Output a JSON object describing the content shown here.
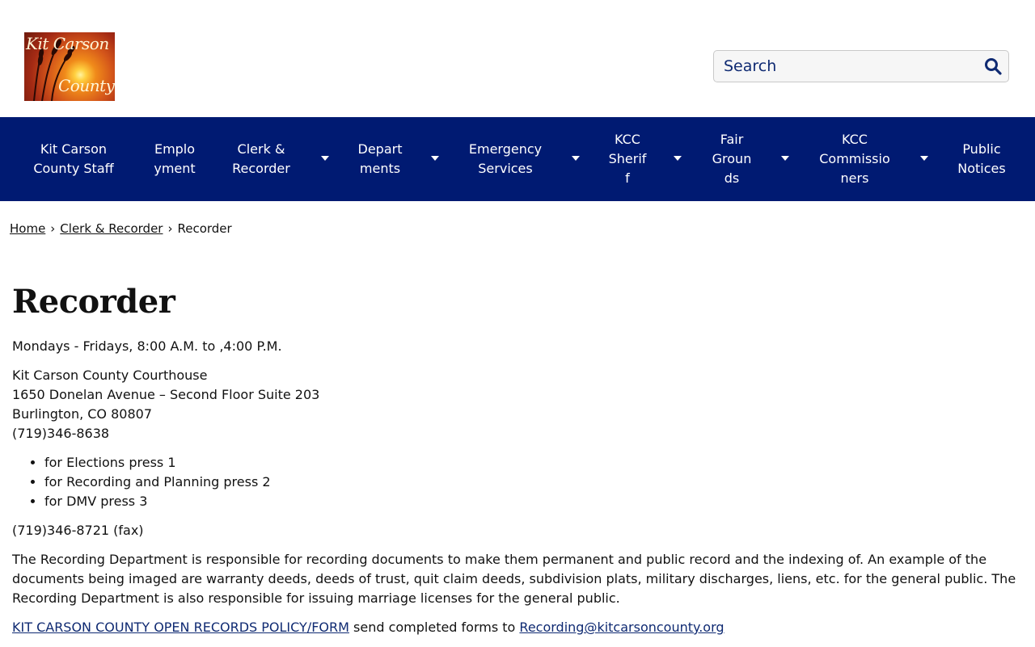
{
  "logo": {
    "line1": "Kit Carson",
    "line2": "County"
  },
  "search": {
    "placeholder": "Search",
    "icon": "search-icon"
  },
  "nav": {
    "items": [
      {
        "label_lines": [
          "Kit Carson",
          "County Staff"
        ],
        "dropdown": false
      },
      {
        "label_lines": [
          "Emplo",
          "yment"
        ],
        "dropdown": false
      },
      {
        "label_lines": [
          "Clerk &",
          "Recorder"
        ],
        "dropdown": true
      },
      {
        "label_lines": [
          "Depart",
          "ments"
        ],
        "dropdown": true
      },
      {
        "label_lines": [
          "Emergency",
          "Services"
        ],
        "dropdown": true
      },
      {
        "label_lines": [
          "KCC",
          "Sherif",
          "f"
        ],
        "dropdown": true
      },
      {
        "label_lines": [
          "Fair",
          "Groun",
          "ds"
        ],
        "dropdown": true
      },
      {
        "label_lines": [
          "KCC",
          "Commissio",
          "ners"
        ],
        "dropdown": true
      },
      {
        "label_lines": [
          "Public",
          "Notices"
        ],
        "dropdown": false
      }
    ],
    "colors": {
      "background": "#001a72",
      "text": "#ffffff"
    }
  },
  "breadcrumb": {
    "home": "Home",
    "parent": "Clerk & Recorder",
    "current": "Recorder",
    "separator": "›"
  },
  "page": {
    "title": "Recorder",
    "hours": "Mondays - Fridays, 8:00 A.M. to ,4:00 P.M.",
    "address_lines": [
      "Kit Carson County Courthouse",
      "1650 Donelan Avenue – Second Floor Suite 203",
      "Burlington, CO 80807",
      "(719)346-8638"
    ],
    "phone_options": [
      "for Elections press 1",
      "for Recording and Planning press 2",
      "for DMV press 3"
    ],
    "fax": "(719)346-8721 (fax)",
    "description": "The Recording Department is responsible for recording documents to make them permanent and public record and the indexing of.  An example of the documents being imaged are warranty deeds, deeds of trust, quit claim deeds, subdivision plats, military discharges, liens, etc. for the general public. The Recording Department is also responsible for issuing marriage licenses for the general public.",
    "policy_link": "KIT CARSON COUNTY OPEN RECORDS POLICY/FORM",
    "policy_text": " send completed forms to ",
    "email_link": "Recording@kitcarsoncounty.org"
  }
}
